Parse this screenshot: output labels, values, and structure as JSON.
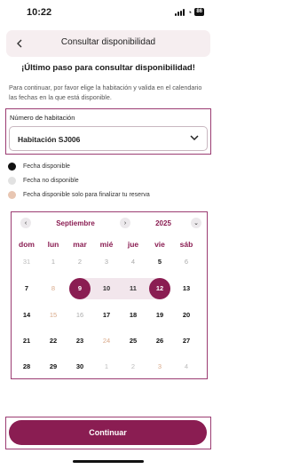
{
  "status_bar": {
    "time": "10:22",
    "battery": "86"
  },
  "header": {
    "title": "Consultar disponibilidad"
  },
  "headline": "¡Último paso para consultar disponibilidad!",
  "intro": "Para continuar, por favor elige la habitación y valida en el calendario las fechas en la que está disponible.",
  "room": {
    "label": "Número de habitación",
    "value": "Habitación SJ006"
  },
  "legend": [
    {
      "label": "Fecha disponible",
      "color": "#111111"
    },
    {
      "label": "Fecha no disponible",
      "color": "#e2e2e2"
    },
    {
      "label": "Fecha disponible solo para finalizar tu reserva",
      "color": "#e8c6b2"
    }
  ],
  "calendar": {
    "month": "Septiembre",
    "year": "2025",
    "weekdays": [
      "dom",
      "lun",
      "mar",
      "mié",
      "jue",
      "vie",
      "sáb"
    ],
    "weeks": [
      [
        {
          "d": "31",
          "s": "outside"
        },
        {
          "d": "1",
          "s": "unavail"
        },
        {
          "d": "2",
          "s": "unavail"
        },
        {
          "d": "3",
          "s": "unavail"
        },
        {
          "d": "4",
          "s": "unavail"
        },
        {
          "d": "5",
          "s": "avail"
        },
        {
          "d": "6",
          "s": "unavail"
        }
      ],
      [
        {
          "d": "7",
          "s": "avail"
        },
        {
          "d": "8",
          "s": "finish"
        },
        {
          "d": "9",
          "s": "selected"
        },
        {
          "d": "10",
          "s": "inrange"
        },
        {
          "d": "11",
          "s": "inrange"
        },
        {
          "d": "12",
          "s": "selected"
        },
        {
          "d": "13",
          "s": "avail"
        }
      ],
      [
        {
          "d": "14",
          "s": "avail"
        },
        {
          "d": "15",
          "s": "finish"
        },
        {
          "d": "16",
          "s": "unavail"
        },
        {
          "d": "17",
          "s": "avail"
        },
        {
          "d": "18",
          "s": "avail"
        },
        {
          "d": "19",
          "s": "avail"
        },
        {
          "d": "20",
          "s": "avail"
        }
      ],
      [
        {
          "d": "21",
          "s": "avail"
        },
        {
          "d": "22",
          "s": "avail"
        },
        {
          "d": "23",
          "s": "avail"
        },
        {
          "d": "24",
          "s": "finish"
        },
        {
          "d": "25",
          "s": "avail"
        },
        {
          "d": "26",
          "s": "avail"
        },
        {
          "d": "27",
          "s": "avail"
        }
      ],
      [
        {
          "d": "28",
          "s": "avail"
        },
        {
          "d": "29",
          "s": "avail"
        },
        {
          "d": "30",
          "s": "avail"
        },
        {
          "d": "1",
          "s": "outside"
        },
        {
          "d": "2",
          "s": "outside"
        },
        {
          "d": "3",
          "s": "finish"
        },
        {
          "d": "4",
          "s": "outside"
        }
      ]
    ]
  },
  "continue_label": "Continuar"
}
